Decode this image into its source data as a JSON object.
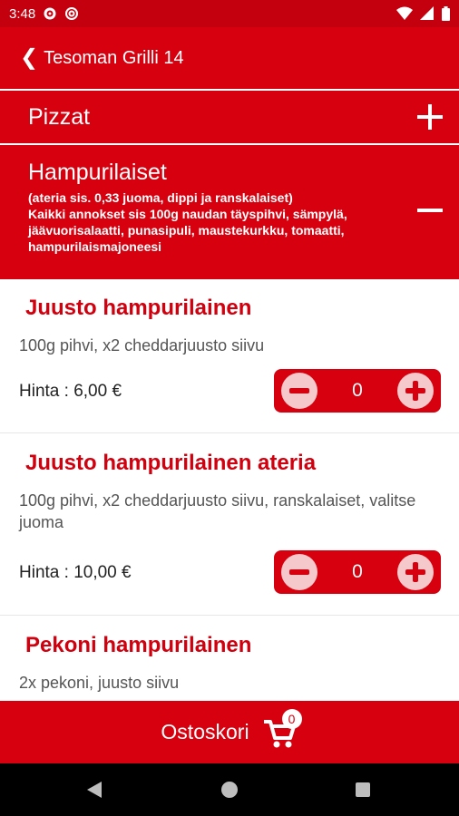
{
  "status_bar": {
    "time": "3:48"
  },
  "app_bar": {
    "title": "Tesoman Grilli 14"
  },
  "categories": [
    {
      "title": "Pizzat",
      "state": "collapsed"
    },
    {
      "title": "Hampurilaiset",
      "state": "expanded",
      "description_lines": [
        "(ateria sis. 0,33 juoma, dippi ja ranskalaiset)",
        "Kaikki annokset sis 100g naudan täyspihvi, sämpylä, jäävuorisalaatti, punasipuli, maustekurkku, tomaatti, hampurilaismajoneesi"
      ]
    }
  ],
  "products": [
    {
      "name": "Juusto hampurilainen",
      "description": "100g pihvi, x2 cheddarjuusto siivu",
      "price": "Hinta : 6,00 €",
      "quantity": "0"
    },
    {
      "name": "Juusto hampurilainen ateria",
      "description": "100g pihvi, x2 cheddarjuusto siivu, ranskalaiset, valitse juoma",
      "price": "Hinta : 10,00 €",
      "quantity": "0"
    },
    {
      "name": "Pekoni hampurilainen",
      "description": "2x pekoni, juusto siivu"
    }
  ],
  "cart": {
    "label": "Ostoskori",
    "count": "0"
  },
  "colors": {
    "primary": "#d6000f",
    "status_bar": "#c4000e",
    "product_title": "#d0000e",
    "button_circle": "#f5c9cb"
  },
  "icons": [
    "settings-icon",
    "at-icon",
    "wifi-icon",
    "signal-icon",
    "battery-icon",
    "back-chevron-icon",
    "plus-icon",
    "minus-icon",
    "cart-icon",
    "nav-back-icon",
    "nav-home-icon",
    "nav-recents-icon"
  ]
}
